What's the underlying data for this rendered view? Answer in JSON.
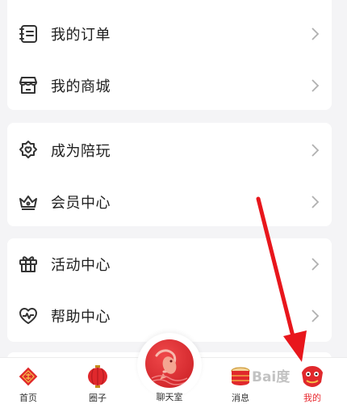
{
  "menu": {
    "group1": [
      {
        "label": "我的订单",
        "icon": "order-list-icon"
      },
      {
        "label": "我的商城",
        "icon": "store-icon"
      }
    ],
    "group2": [
      {
        "label": "成为陪玩",
        "icon": "heart-badge-icon"
      },
      {
        "label": "会员中心",
        "icon": "crown-icon"
      }
    ],
    "group3": [
      {
        "label": "活动中心",
        "icon": "gift-icon"
      },
      {
        "label": "帮助中心",
        "icon": "heartbeat-icon"
      }
    ]
  },
  "tabbar": {
    "tabs": [
      {
        "label": "首页",
        "icon": "fu-lantern-icon"
      },
      {
        "label": "圈子",
        "icon": "red-lantern-icon"
      },
      {
        "label": "聊天室",
        "icon": "koi-fish-icon"
      },
      {
        "label": "消息",
        "icon": "drum-icon"
      },
      {
        "label": "我的",
        "icon": "lion-head-icon"
      }
    ],
    "active": "我的"
  },
  "colors": {
    "accent": "#e8282e",
    "text": "#1e1e1e",
    "background": "#f4f4f6",
    "card": "#ffffff",
    "icon_stroke": "#333333"
  }
}
